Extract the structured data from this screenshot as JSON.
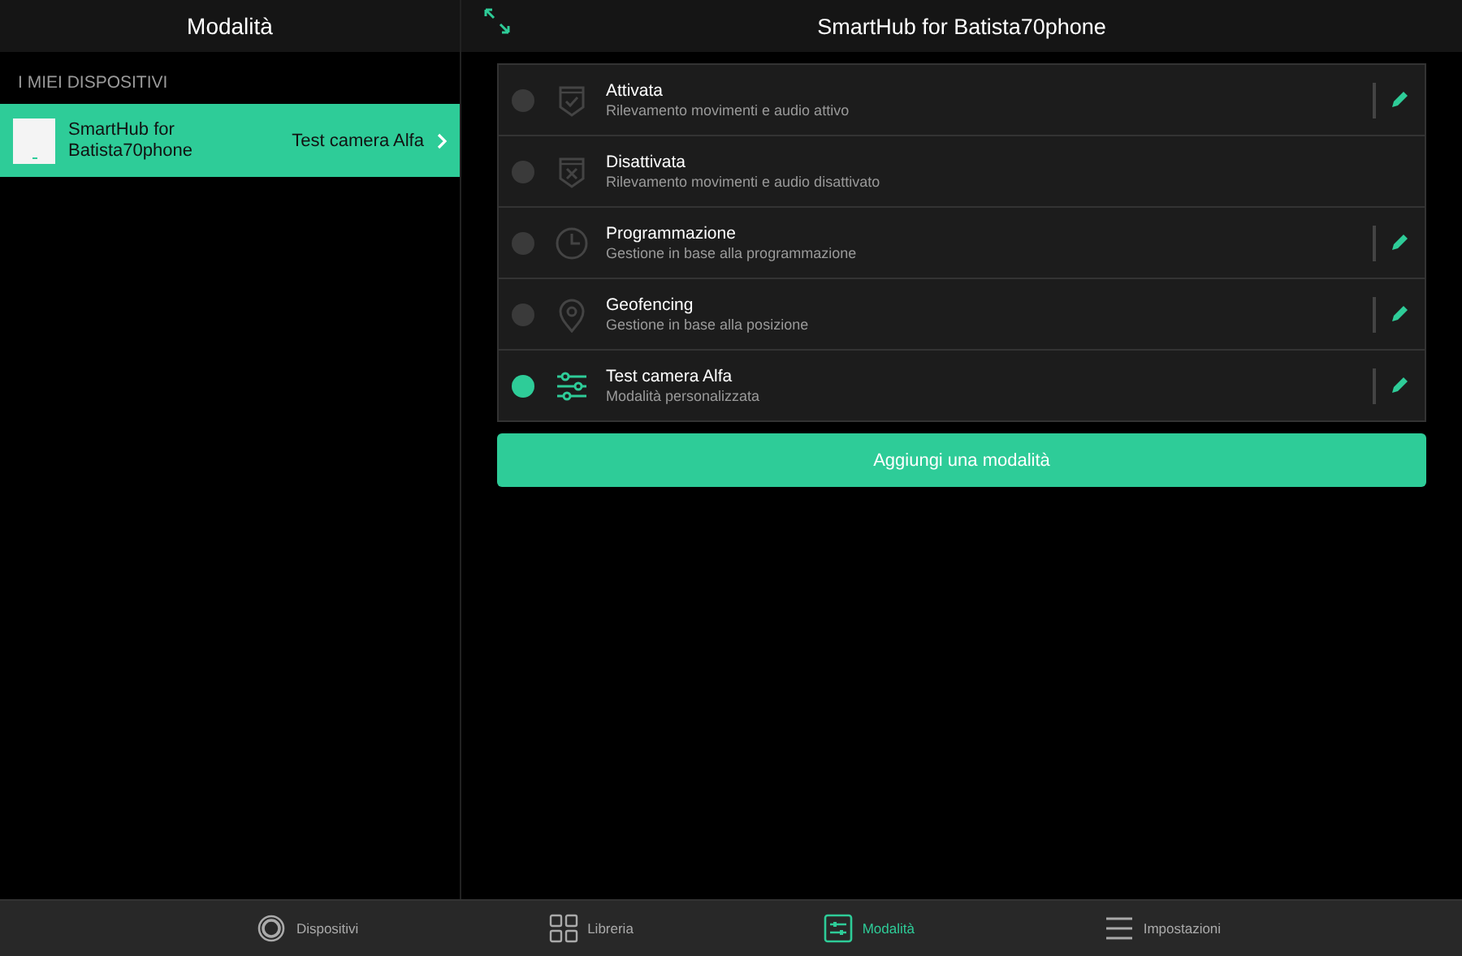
{
  "left_header": {
    "title": "Modalità"
  },
  "right_header": {
    "title": "SmartHub for Batista70phone"
  },
  "devices": {
    "section_title": "I MIEI DISPOSITIVI",
    "items": [
      {
        "name": "SmartHub for Batista70phone",
        "mode": "Test camera Alfa",
        "selected": true
      }
    ]
  },
  "modes": [
    {
      "kind": "armed",
      "title": "Attivata",
      "subtitle": "Rilevamento movimenti e audio attivo",
      "selected": false,
      "editable": true
    },
    {
      "kind": "disarmed",
      "title": "Disattivata",
      "subtitle": "Rilevamento movimenti e audio disattivato",
      "selected": false,
      "editable": false
    },
    {
      "kind": "schedule",
      "title": "Programmazione",
      "subtitle": "Gestione in base alla programmazione",
      "selected": false,
      "editable": true
    },
    {
      "kind": "geofence",
      "title": "Geofencing",
      "subtitle": "Gestione in base alla posizione",
      "selected": false,
      "editable": true
    },
    {
      "kind": "custom",
      "title": "Test camera Alfa",
      "subtitle": "Modalità personalizzata",
      "selected": true,
      "editable": true
    }
  ],
  "add_button": "Aggiungi una modalità",
  "tab_bar": [
    {
      "kind": "devices",
      "label": "Dispositivi",
      "selected": false
    },
    {
      "kind": "library",
      "label": "Libreria",
      "selected": false
    },
    {
      "kind": "modes",
      "label": "Modalità",
      "selected": true
    },
    {
      "kind": "settings",
      "label": "Impostazioni",
      "selected": false
    }
  ]
}
